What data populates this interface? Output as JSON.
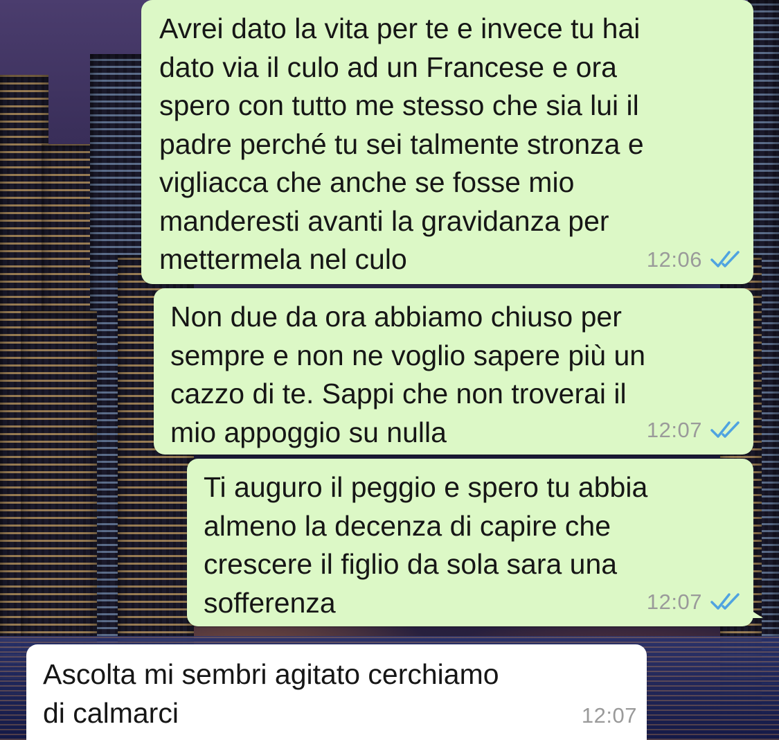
{
  "messages": [
    {
      "direction": "outgoing",
      "text": "Avrei dato la vita per te e invece tu hai\ndato via il culo ad un Francese e ora\nspero con tutto me stesso che sia lui il\npadre perché tu sei talmente stronza e\nvigliacca che anche se fosse mio\nmanderesti avanti la gravidanza per\nmettermela nel culo",
      "time": "12:06",
      "status_icon": "double-check-read-icon"
    },
    {
      "direction": "outgoing",
      "text": "Non due da ora abbiamo chiuso per\nsempre e non ne voglio sapere più un\ncazzo di te. Sappi che non troverai il\nmio appoggio su nulla",
      "time": "12:07",
      "status_icon": "double-check-read-icon"
    },
    {
      "direction": "outgoing",
      "text": "Ti auguro il peggio e spero tu abbia\nalmeno la decenza di capire che\ncrescere il figlio da sola sara una\nsofferenza",
      "time": "12:07",
      "status_icon": "double-check-read-icon"
    },
    {
      "direction": "incoming",
      "text": "Ascolta mi sembri agitato cerchiamo\ndi calmarci",
      "time": "12:07"
    }
  ],
  "colors": {
    "outgoing_bubble": "#dcf8c6",
    "incoming_bubble": "#ffffff",
    "read_tick": "#4fa3e0",
    "timestamp": "#9a9a9a"
  }
}
